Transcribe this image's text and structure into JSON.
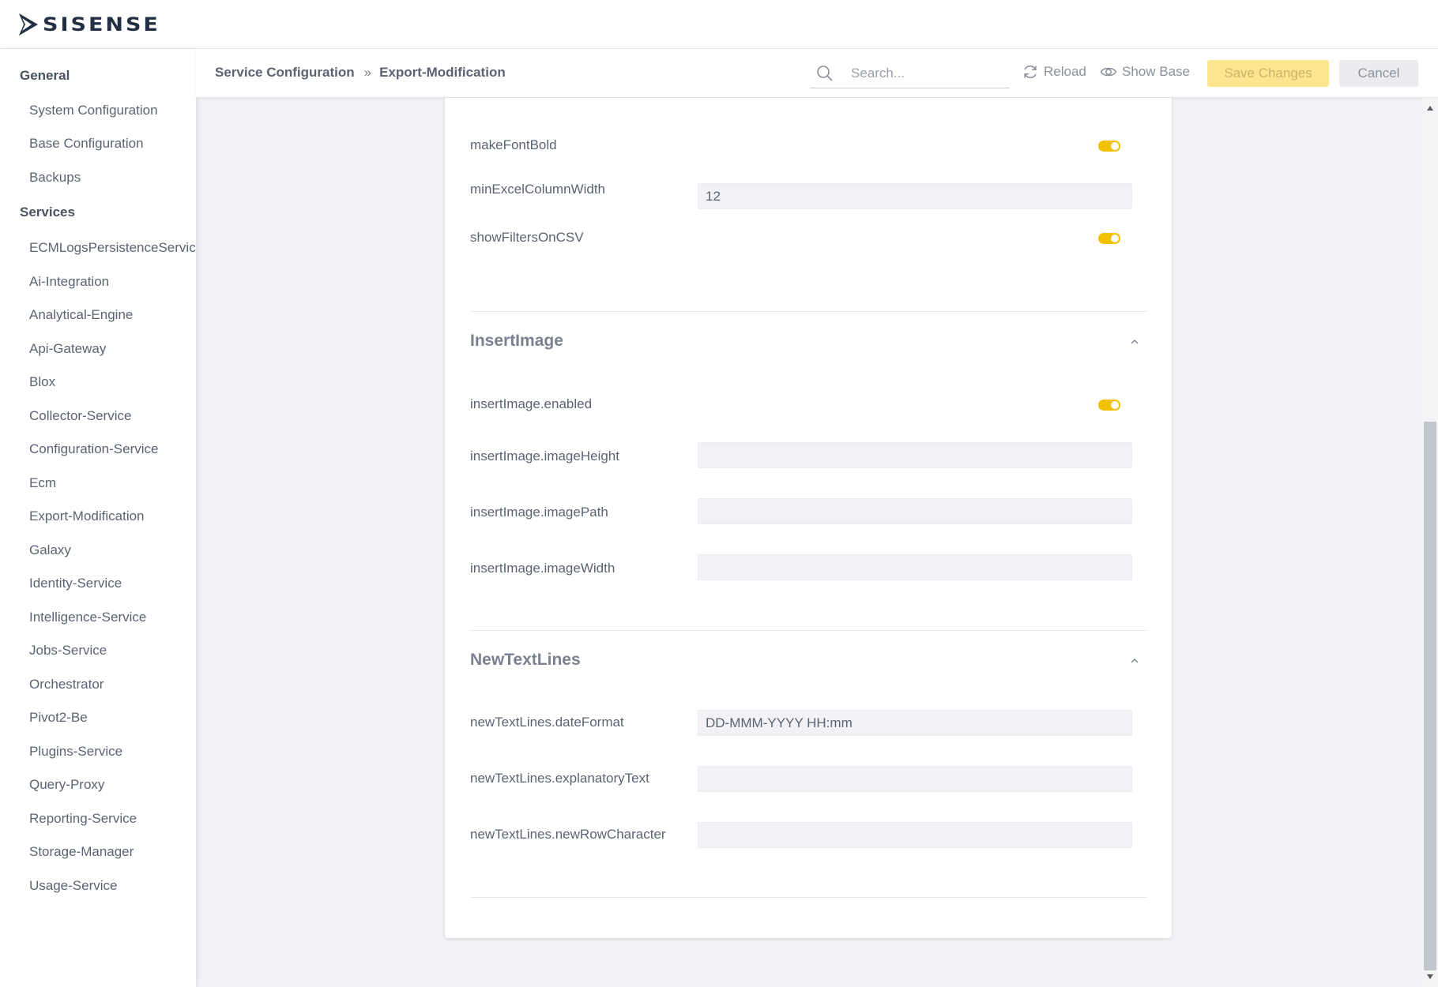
{
  "app": {
    "logo_text": "SISENSE"
  },
  "sidebar": {
    "sections": [
      {
        "title": "General",
        "items": [
          "System Configuration",
          "Base Configuration",
          "Backups"
        ]
      },
      {
        "title": "Services",
        "items": [
          "ECMLogsPersistenceService",
          "Ai-Integration",
          "Analytical-Engine",
          "Api-Gateway",
          "Blox",
          "Collector-Service",
          "Configuration-Service",
          "Ecm",
          "Export-Modification",
          "Galaxy",
          "Identity-Service",
          "Intelligence-Service",
          "Jobs-Service",
          "Orchestrator",
          "Pivot2-Be",
          "Plugins-Service",
          "Query-Proxy",
          "Reporting-Service",
          "Storage-Manager",
          "Usage-Service"
        ]
      }
    ]
  },
  "header": {
    "breadcrumb": [
      "Service Configuration",
      "Export-Modification"
    ],
    "breadcrumb_separator": "»",
    "search_placeholder": "Search...",
    "reload_label": "Reload",
    "show_base_label": "Show Base",
    "save_label": "Save Changes",
    "cancel_label": "Cancel"
  },
  "content": {
    "rows_top": [
      {
        "label": "makeFontBold",
        "type": "toggle",
        "on": true
      },
      {
        "label": "minExcelColumnWidth",
        "type": "input",
        "value": "12"
      },
      {
        "label": "showFiltersOnCSV",
        "type": "toggle",
        "on": true
      }
    ],
    "sections": [
      {
        "title": "InsertImage",
        "rows": [
          {
            "label": "insertImage.enabled",
            "type": "toggle",
            "on": true
          },
          {
            "label": "insertImage.imageHeight",
            "type": "input",
            "value": ""
          },
          {
            "label": "insertImage.imagePath",
            "type": "input",
            "value": ""
          },
          {
            "label": "insertImage.imageWidth",
            "type": "input",
            "value": ""
          }
        ]
      },
      {
        "title": "NewTextLines",
        "rows": [
          {
            "label": "newTextLines.dateFormat",
            "type": "input",
            "value": "DD-MMM-YYYY HH:mm"
          },
          {
            "label": "newTextLines.explanatoryText",
            "type": "input",
            "value": ""
          },
          {
            "label": "newTextLines.newRowCharacter",
            "type": "input",
            "value": ""
          }
        ]
      }
    ]
  },
  "colors": {
    "accent": "#f2c200",
    "save_bg": "#fde58f",
    "background": "#f2f2f6"
  }
}
